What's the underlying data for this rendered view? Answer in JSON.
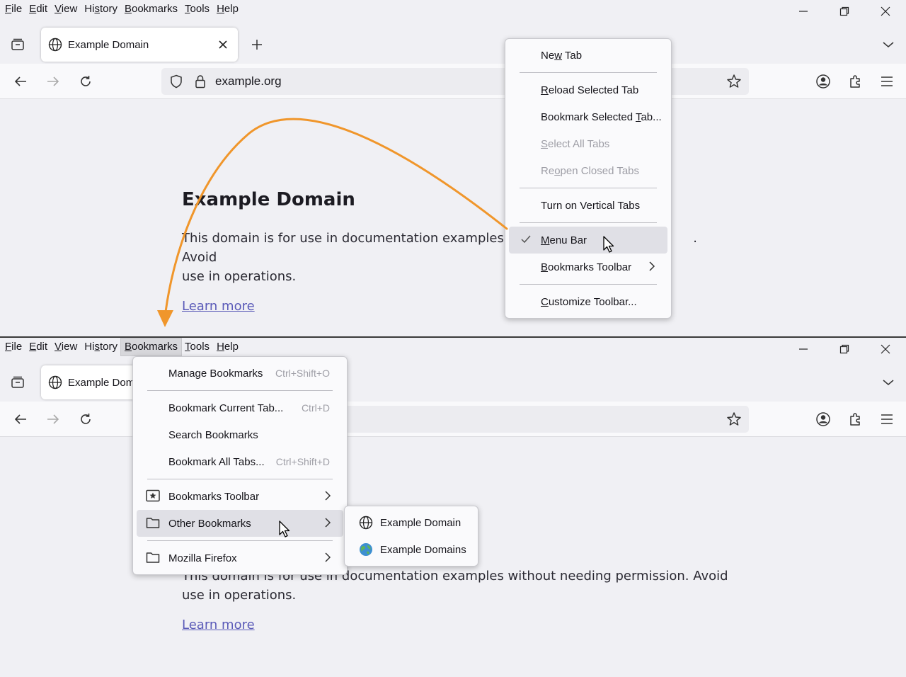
{
  "menubar": {
    "items": [
      {
        "label": "File"
      },
      {
        "label": "Edit"
      },
      {
        "label": "View"
      },
      {
        "label": "History"
      },
      {
        "label": "Bookmarks"
      },
      {
        "label": "Tools"
      },
      {
        "label": "Help"
      }
    ]
  },
  "tab": {
    "title_top": "Example Domain",
    "title_bottom": "Example Dom"
  },
  "urlbar": {
    "url": "example.org"
  },
  "page": {
    "heading": "Example Domain",
    "paragraph_top": "This domain is for use in documentation examples v",
    "paragraph_top_tail": ". Avoid",
    "paragraph_top_line2": "use in operations.",
    "paragraph_bottom": "This domain is for use in documentation examples without needing permission. Avoid",
    "paragraph_bottom_line2": "use in operations.",
    "link": "Learn more"
  },
  "context_menu": {
    "new_tab": "New Tab",
    "reload_selected_tab": "Reload Selected Tab",
    "bookmark_selected_tab": "Bookmark Selected Tab...",
    "select_all_tabs": "Select All Tabs",
    "reopen_closed_tabs": "Reopen Closed Tabs",
    "turn_on_vertical_tabs": "Turn on Vertical Tabs",
    "menu_bar": "Menu Bar",
    "bookmarks_toolbar": "Bookmarks Toolbar",
    "customize_toolbar": "Customize Toolbar..."
  },
  "bookmarks_menu": {
    "manage_bookmarks": "Manage Bookmarks",
    "manage_bookmarks_accel": "Ctrl+Shift+O",
    "bookmark_current_tab": "Bookmark Current Tab...",
    "bookmark_current_tab_accel": "Ctrl+D",
    "search_bookmarks": "Search Bookmarks",
    "bookmark_all_tabs": "Bookmark All Tabs...",
    "bookmark_all_tabs_accel": "Ctrl+Shift+D",
    "bookmarks_toolbar": "Bookmarks Toolbar",
    "other_bookmarks": "Other Bookmarks",
    "mozilla_firefox": "Mozilla Firefox"
  },
  "other_bookmarks_submenu": {
    "items": [
      {
        "label": "Example Domain"
      },
      {
        "label": "Example Domains"
      }
    ]
  },
  "colors": {
    "annotation_arrow": "#f0962b",
    "link": "#5a5ab8"
  }
}
